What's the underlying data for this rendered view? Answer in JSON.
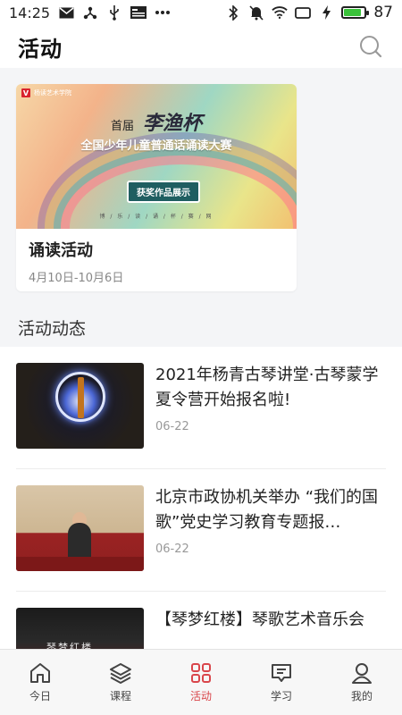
{
  "status_bar": {
    "time": "14:25",
    "battery": "87",
    "battery_level": 0.87,
    "left_icons": [
      "mail-icon",
      "share-icon",
      "usb-icon",
      "news-icon",
      "more-dots-icon"
    ],
    "right_icons": [
      "bluetooth-icon",
      "mute-icon",
      "wifi-icon",
      "sim-icon",
      "charging-icon",
      "battery-icon"
    ]
  },
  "header": {
    "title": "活动",
    "search_icon": "search-icon"
  },
  "featured": {
    "banner": {
      "logo_text": "杨读艺术学院",
      "heading": "首届",
      "cal_title": "李渔杯",
      "subtitle": "全国少年儿童普通话诵读大赛",
      "chip": "获奖作品展示",
      "foot": "博 / 乐 / 读 / 诵 / 杯 / 赛 / 网"
    },
    "name": "诵读活动",
    "date": "4月10日-10月6日"
  },
  "section_title": "活动动态",
  "news": [
    {
      "title": "2021年杨青古琴讲堂·古琴蒙学夏令营开始报名啦!",
      "date": "06-22"
    },
    {
      "title": "北京市政协机关举办 “我们的国歌”党史学习教育专题报…",
      "date": "06-22"
    },
    {
      "title": "【琴梦红楼】琴歌艺术音乐会",
      "date": "",
      "thumb_text": "琴梦红楼"
    }
  ],
  "tabs": [
    {
      "label": "今日",
      "icon": "home-icon",
      "active": false
    },
    {
      "label": "课程",
      "icon": "layers-icon",
      "active": false
    },
    {
      "label": "活动",
      "icon": "grid-icon",
      "active": true
    },
    {
      "label": "学习",
      "icon": "message-board-icon",
      "active": false
    },
    {
      "label": "我的",
      "icon": "user-icon",
      "active": false
    }
  ],
  "colors": {
    "accent": "#d9464b",
    "battery_green": "#3ac23a"
  }
}
